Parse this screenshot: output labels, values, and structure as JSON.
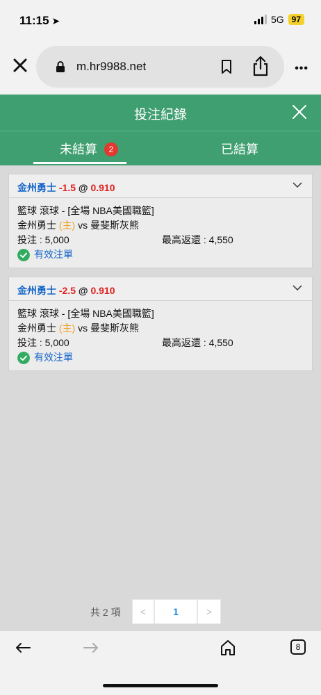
{
  "status_bar": {
    "time": "11:15",
    "network": "5G",
    "battery": "97"
  },
  "browser": {
    "url": "m.hr9988.net",
    "open_tabs": "8"
  },
  "header": {
    "title": "投注紀錄"
  },
  "tabs": [
    {
      "label": "未結算",
      "badge": "2"
    },
    {
      "label": "已結算"
    }
  ],
  "bets": [
    {
      "team": "金州勇士",
      "handicap": "-1.5",
      "at": "@",
      "odds": "0.910",
      "league": "籃球 滾球 - [全場 NBA美國職籃]",
      "home_team": "金州勇士",
      "host_mark": "(主)",
      "vs": "vs",
      "away_team": "曼斐斯灰熊",
      "stake": "投注 : 5,000",
      "max_return": "最高返還 : 4,550",
      "status": "有效注單"
    },
    {
      "team": "金州勇士",
      "handicap": "-2.5",
      "at": "@",
      "odds": "0.910",
      "league": "籃球 滾球 - [全場 NBA美國職籃]",
      "home_team": "金州勇士",
      "host_mark": "(主)",
      "vs": "vs",
      "away_team": "曼斐斯灰熊",
      "stake": "投注 : 5,000",
      "max_return": "最高返還 : 4,550",
      "status": "有效注單"
    }
  ],
  "pagination": {
    "total": "共 2 項",
    "prev": "<",
    "current": "1",
    "next": ">"
  },
  "colors": {
    "header_green": "#3f9f71",
    "team_blue": "#1767c9",
    "odds_red": "#e01e1e",
    "host_orange": "#f0a020",
    "valid_green": "#33ac62"
  }
}
